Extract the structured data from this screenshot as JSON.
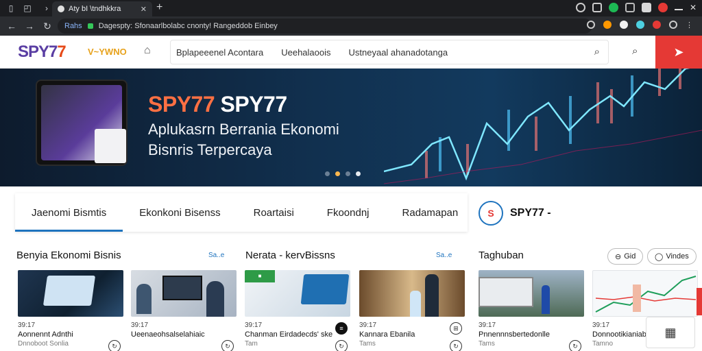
{
  "browser": {
    "tab_title": "Aty bI \\tndhkkra",
    "tab_close": "✕",
    "new_tab": "+",
    "url_prefix": "Rahs",
    "url": "Dagespty: Sfonaarlbolabc cnonty! Rangeddob Einbey"
  },
  "header": {
    "logo_part1": "SPY7",
    "logo_part2": "7",
    "sub_logo": "V~YWNO",
    "nav_items": [
      "Bplapeeenel Acontara",
      "Ueehalaoois",
      "Ustneyaal ahanadotanga"
    ]
  },
  "hero": {
    "title_part1": "SPY77",
    "title_part2": "SPY77",
    "subtitle_line1": "Aplukasrn Berrania Ekonomi",
    "subtitle_line2": "Bisnris Terpercaya"
  },
  "categories": {
    "tabs": [
      "Jaenomi Bismtis",
      "Ekonkoni Bisenss",
      "Roartaisi",
      "Fkoondnj",
      "Radamapan"
    ],
    "arrow": "›"
  },
  "profile": {
    "name": "SPY77 -",
    "avatar_text": "S"
  },
  "sections": [
    {
      "title": "Benyia Ekonomi Bisnis",
      "more": "Sa..e"
    },
    {
      "title": "Nerata - kervBissns",
      "more": "Sa..e"
    },
    {
      "title": "Taghuban",
      "pills": [
        "Gid",
        "Vindes"
      ]
    }
  ],
  "cards": [
    {
      "meta": "39:17",
      "title": "Aonnennt Adnthi",
      "foot": "Dnnoboot Sonlia",
      "icon": "↻"
    },
    {
      "meta": "39:17",
      "title": "Ueenaeohsalselahiaic",
      "foot": "",
      "icon": "↻"
    },
    {
      "meta": "39:17",
      "title": "Chanman Eirdadecds' ske",
      "foot": "Tam",
      "icon": "↻",
      "top_icon": "≡"
    },
    {
      "meta": "39:17",
      "title": "Kannara Ebanila",
      "foot": "Tams",
      "icon": "↻",
      "top_icon": "⊞"
    },
    {
      "meta": "39:17",
      "title": "Pnnennnsbertedonlle",
      "foot": "Tams",
      "icon": "↻"
    },
    {
      "meta": "39:17",
      "title": "Donnootikianiabt",
      "foot": "Tamno",
      "icon": ""
    }
  ],
  "colors": {
    "brand_purple": "#5a3ea3",
    "brand_orange": "#e64a19",
    "accent_blue": "#1e73be",
    "hero_dark": "#0d1b2d",
    "alert_red": "#e53935"
  }
}
